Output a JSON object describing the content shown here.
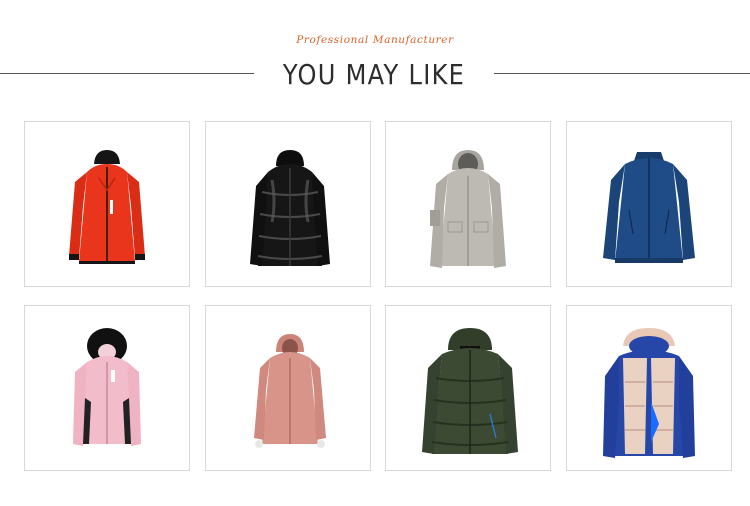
{
  "header": {
    "tagline": "Professional Manufacturer",
    "title": "YOU MAY LIKE"
  },
  "products": [
    {
      "icon": "red-ski-jacket-image",
      "color": "#e8351b"
    },
    {
      "icon": "black-glossy-puffer-jacket-image",
      "color": "#151515"
    },
    {
      "icon": "grey-hooded-jacket-image",
      "color": "#b6b3ae"
    },
    {
      "icon": "navy-blue-soft-shell-jacket-image",
      "color": "#1f4c86"
    },
    {
      "icon": "pink-fur-hood-ski-jacket-image",
      "color": "#f2bccb"
    },
    {
      "icon": "salmon-pink-rain-jacket-image",
      "color": "#d9948a"
    },
    {
      "icon": "olive-green-puffer-jacket-image",
      "color": "#3d4a33"
    },
    {
      "icon": "blue-beige-puffer-vest-jacket-image",
      "color": "#2747a8"
    }
  ]
}
